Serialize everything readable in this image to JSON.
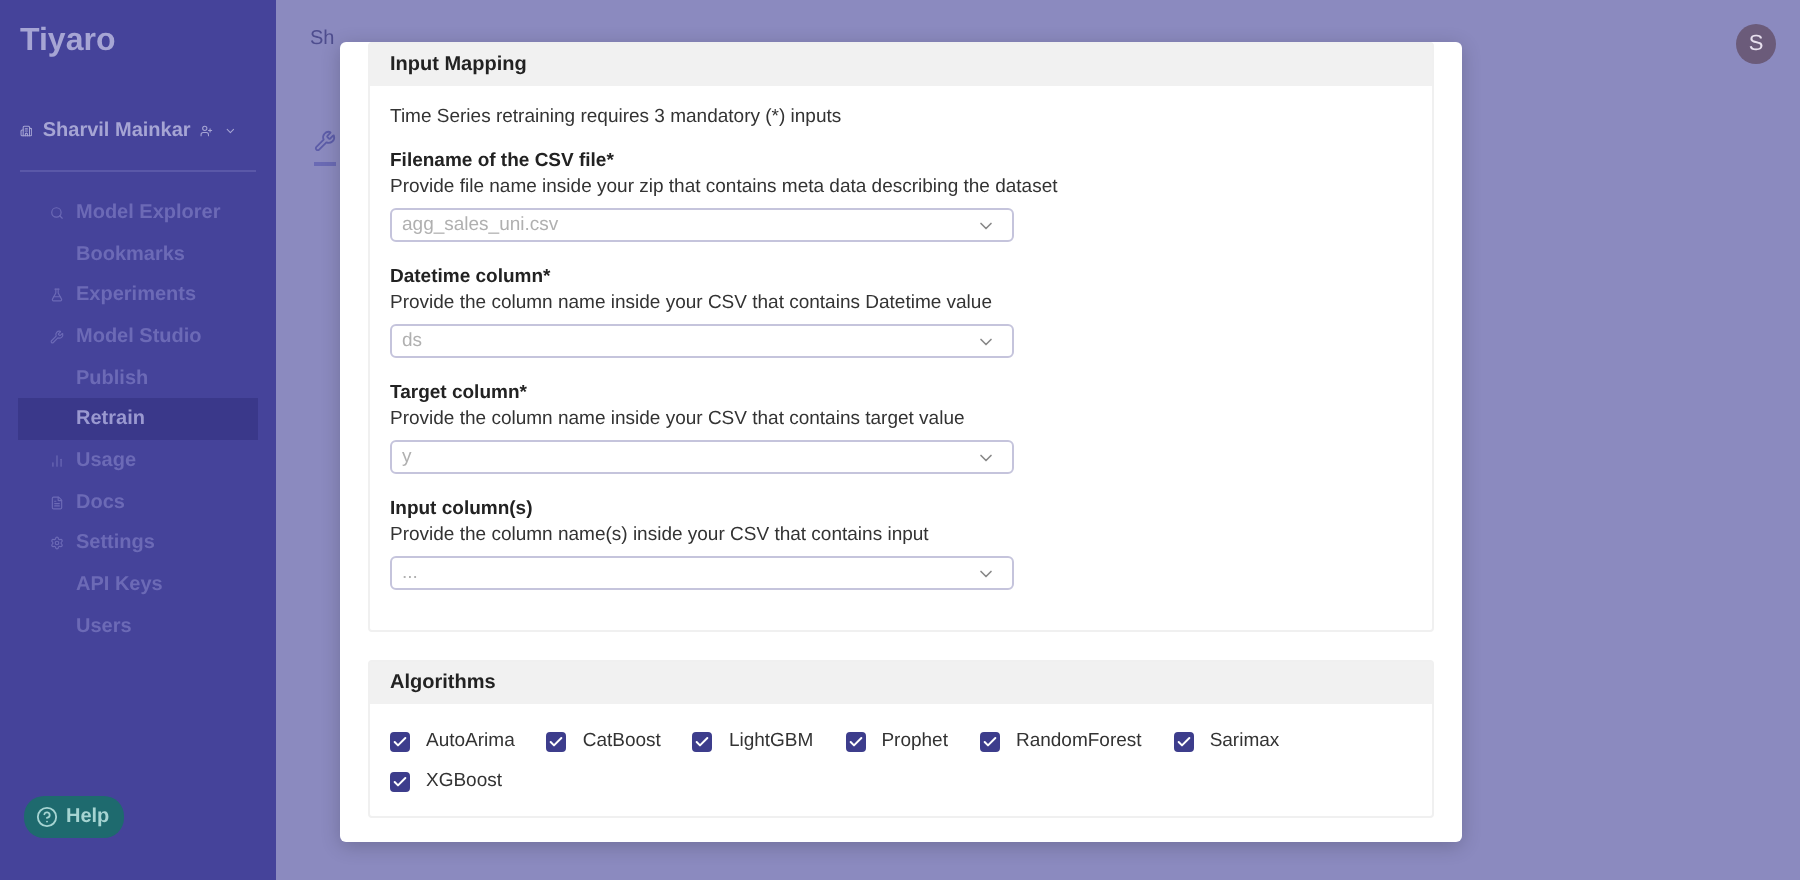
{
  "sidebar": {
    "logo": "Tiyaro",
    "user": {
      "name": "Sharvil Mainkar"
    },
    "items": [
      {
        "label": "Model Explorer",
        "selected": false,
        "children": [
          {
            "label": "Bookmarks",
            "selected": false
          }
        ]
      },
      {
        "label": "Experiments",
        "selected": false
      },
      {
        "label": "Model Studio",
        "selected": false,
        "children": [
          {
            "label": "Publish",
            "selected": false
          },
          {
            "label": "Retrain",
            "selected": true
          }
        ]
      },
      {
        "label": "Usage",
        "selected": false
      },
      {
        "label": "Docs",
        "selected": false
      },
      {
        "label": "Settings",
        "selected": false,
        "children": [
          {
            "label": "API Keys",
            "selected": false
          },
          {
            "label": "Users",
            "selected": false
          }
        ]
      }
    ],
    "help": "Help"
  },
  "header": {
    "breadcrumb": "Sh",
    "avatar": "S"
  },
  "modal": {
    "mapping": {
      "title": "Input Mapping",
      "intro": "Time Series retraining requires 3 mandatory (*) inputs",
      "fields": [
        {
          "label": "Filename of the CSV file*",
          "hint": "Provide file name inside your zip that contains meta data describing the dataset",
          "value": "agg_sales_uni.csv"
        },
        {
          "label": "Datetime column*",
          "hint": "Provide the column name inside your CSV that contains Datetime value",
          "value": "ds"
        },
        {
          "label": "Target column*",
          "hint": "Provide the column name inside your CSV that contains target value",
          "value": "y"
        },
        {
          "label": "Input column(s)",
          "hint": "Provide the column name(s) inside your CSV that contains input",
          "value": "..."
        }
      ]
    },
    "algorithms": {
      "title": "Algorithms",
      "items": [
        {
          "label": "AutoArima",
          "checked": true
        },
        {
          "label": "CatBoost",
          "checked": true
        },
        {
          "label": "LightGBM",
          "checked": true
        },
        {
          "label": "Prophet",
          "checked": true
        },
        {
          "label": "RandomForest",
          "checked": true
        },
        {
          "label": "Sarimax",
          "checked": true
        },
        {
          "label": "XGBoost",
          "checked": true
        }
      ]
    }
  }
}
